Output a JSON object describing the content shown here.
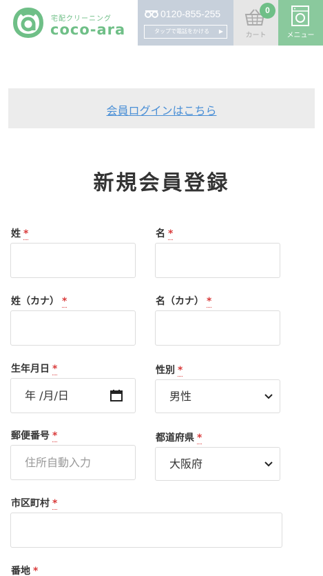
{
  "header": {
    "logo_sub": "宅配クリーニング",
    "logo_main": "coco-ara",
    "phone_number": "0120-855-255",
    "phone_cta": "タップで電話をかける",
    "cart_label": "カート",
    "cart_count": "0",
    "menu_label": "メニュー"
  },
  "login": {
    "link_text": "会員ログインはこちら"
  },
  "page_title": "新規会員登録",
  "required_mark": "*",
  "form": {
    "last_name": {
      "label": "姓",
      "value": ""
    },
    "first_name": {
      "label": "名",
      "value": ""
    },
    "last_name_kana": {
      "label": "姓（カナ）",
      "value": ""
    },
    "first_name_kana": {
      "label": "名（カナ）",
      "value": ""
    },
    "birthdate": {
      "label": "生年月日",
      "value": "年 /月/日"
    },
    "gender": {
      "label": "性別",
      "value": "男性"
    },
    "postal_code": {
      "label": "郵便番号",
      "placeholder": "住所自動入力"
    },
    "prefecture": {
      "label": "都道府県",
      "value": "大阪府"
    },
    "city": {
      "label": "市区町村",
      "value": ""
    },
    "street": {
      "label": "番地"
    }
  },
  "colors": {
    "brand_green": "#6fbf87",
    "menu_green": "#8ac99d",
    "phone_bg": "#c7d0db",
    "link_blue": "#4a8fd6",
    "required_red": "#d93b3b"
  },
  "icons": {
    "logo": "coco-ara-logo-icon",
    "phone": "free-dial-icon",
    "cart": "basket-icon",
    "menu": "washing-machine-icon",
    "calendar": "calendar-icon",
    "select": "chevron-down-icon"
  }
}
